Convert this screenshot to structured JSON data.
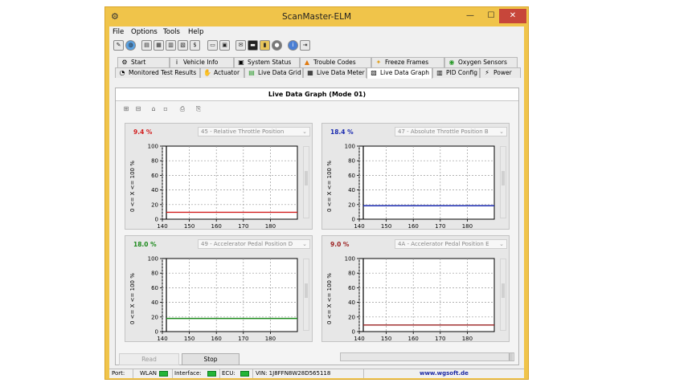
{
  "window": {
    "title": "ScanMaster-ELM",
    "minimize": "—",
    "maximize": "☐",
    "close": "✕"
  },
  "menu": [
    "File",
    "Options",
    "Tools",
    "Help"
  ],
  "tabs_row1": [
    {
      "label": "Start",
      "icon": "car-icon"
    },
    {
      "label": "Vehicle Info",
      "icon": "info-icon"
    },
    {
      "label": "System Status",
      "icon": "monitor-icon"
    },
    {
      "label": "Trouble Codes",
      "icon": "warning-icon"
    },
    {
      "label": "Freeze Frames",
      "icon": "snapshot-icon"
    },
    {
      "label": "Oxygen Sensors",
      "icon": "sensor-icon"
    }
  ],
  "tabs_row2": [
    {
      "label": "Monitored Test Results",
      "icon": "gauge-icon"
    },
    {
      "label": "Actuator",
      "icon": "actuator-icon"
    },
    {
      "label": "Live Data Grid",
      "icon": "grid-icon"
    },
    {
      "label": "Live Data Meter",
      "icon": "meter-icon"
    },
    {
      "label": "Live Data Graph",
      "icon": "graph-icon"
    },
    {
      "label": "PID Config",
      "icon": "config-icon"
    },
    {
      "label": "Power",
      "icon": "power-icon"
    }
  ],
  "panel": {
    "title": "Live Data Graph (Mode 01)"
  },
  "graphs": [
    {
      "value": "9.4 %",
      "pid": "45 - Relative Throttle Position",
      "ylabel": "0 <= X <= 100 %",
      "color": "#d21f1f",
      "level": 9.4
    },
    {
      "value": "18.4 %",
      "pid": "47 - Absolute Throttle Position B",
      "ylabel": "0 <= X <= 100 %",
      "color": "#1b2bb0",
      "level": 18.4
    },
    {
      "value": "18.0 %",
      "pid": "49 - Accelerator Pedal Position D",
      "ylabel": "0 <= X <= 100 %",
      "color": "#1c8a1c",
      "level": 18.0
    },
    {
      "value": "9.0 %",
      "pid": "4A - Accelerator Pedal Position E",
      "ylabel": "0 <= X <= 100 %",
      "color": "#9a1e1e",
      "level": 9.0
    }
  ],
  "axis": {
    "y_ticks": [
      "0",
      "20",
      "40",
      "60",
      "80",
      "100"
    ],
    "x_ticks": [
      "140",
      "150",
      "160",
      "170",
      "180"
    ]
  },
  "buttons": {
    "read": "Read",
    "stop": "Stop"
  },
  "status": {
    "port": "Port:",
    "wlan": "WLAN",
    "interface": "Interface:",
    "ecu": "ECU:",
    "vin": "VIN: 1J8FFN8W28D565118",
    "website": "www.wgsoft.de"
  }
}
